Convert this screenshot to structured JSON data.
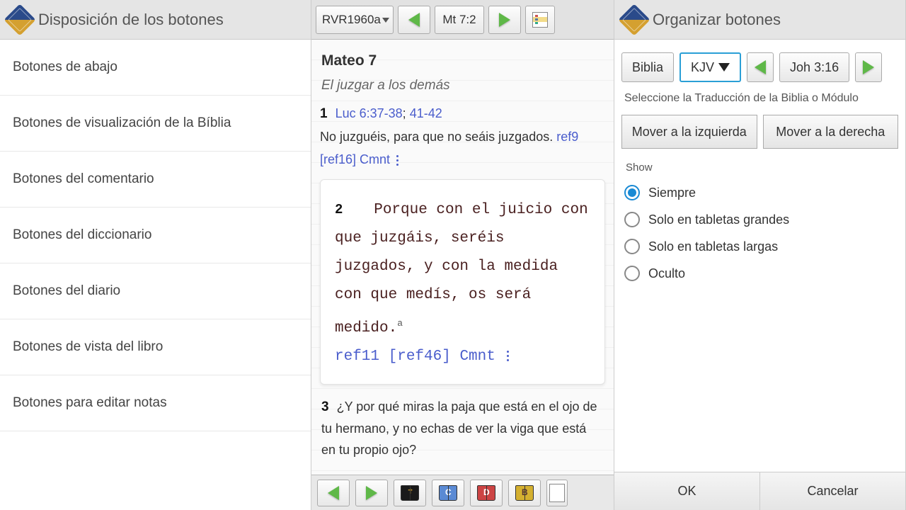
{
  "panel1": {
    "title": "Disposición de los botones",
    "items": [
      "Botones de abajo",
      "Botones de visualización de la Bíblia",
      "Botones del comentario",
      "Botones del diccionario",
      "Botones del diario",
      "Botones de vista del libro",
      "Botones para editar notas"
    ]
  },
  "panel2": {
    "version": "RVR1960a",
    "reference": "Mt 7:2",
    "chapter_title": "Mateo 7",
    "section_title": "El juzgar a los demás",
    "verse1": {
      "num": "1",
      "xref1": "Luc 6:37-38",
      "xref_sep": "; ",
      "xref2": "41-42",
      "text": "No juzguéis, para que no seáis juzgados. ",
      "ref_a": "ref9",
      "ref_b": "[ref16]",
      "cmnt": "Cmnt"
    },
    "verse2": {
      "num": "2",
      "text": "Porque con el juicio con que juzgáis, seréis juzgados, y con la medida con que medís, os será medido.",
      "sup": "a",
      "ref_a": "ref11",
      "ref_b": "[ref46]",
      "cmnt": "Cmnt"
    },
    "verse3": {
      "num": "3",
      "text": "¿Y por qué miras la paja que está en el ojo de tu hermano, y no echas de ver la viga que está en tu propio ojo?"
    }
  },
  "panel3": {
    "title": "Organizar botones",
    "toolbar": {
      "biblia": "Biblia",
      "kjv": "KJV",
      "ref": "Joh 3:16"
    },
    "caption": "Seleccione la Traducción de la Biblia o Módulo",
    "move_left": "Mover a la izquierda",
    "move_right": "Mover a la derecha",
    "show_label": "Show",
    "radios": [
      {
        "label": "Siempre",
        "checked": true
      },
      {
        "label": "Solo en tabletas grandes",
        "checked": false
      },
      {
        "label": "Solo en tabletas largas",
        "checked": false
      },
      {
        "label": "Oculto",
        "checked": false
      }
    ],
    "ok": "OK",
    "cancel": "Cancelar"
  }
}
